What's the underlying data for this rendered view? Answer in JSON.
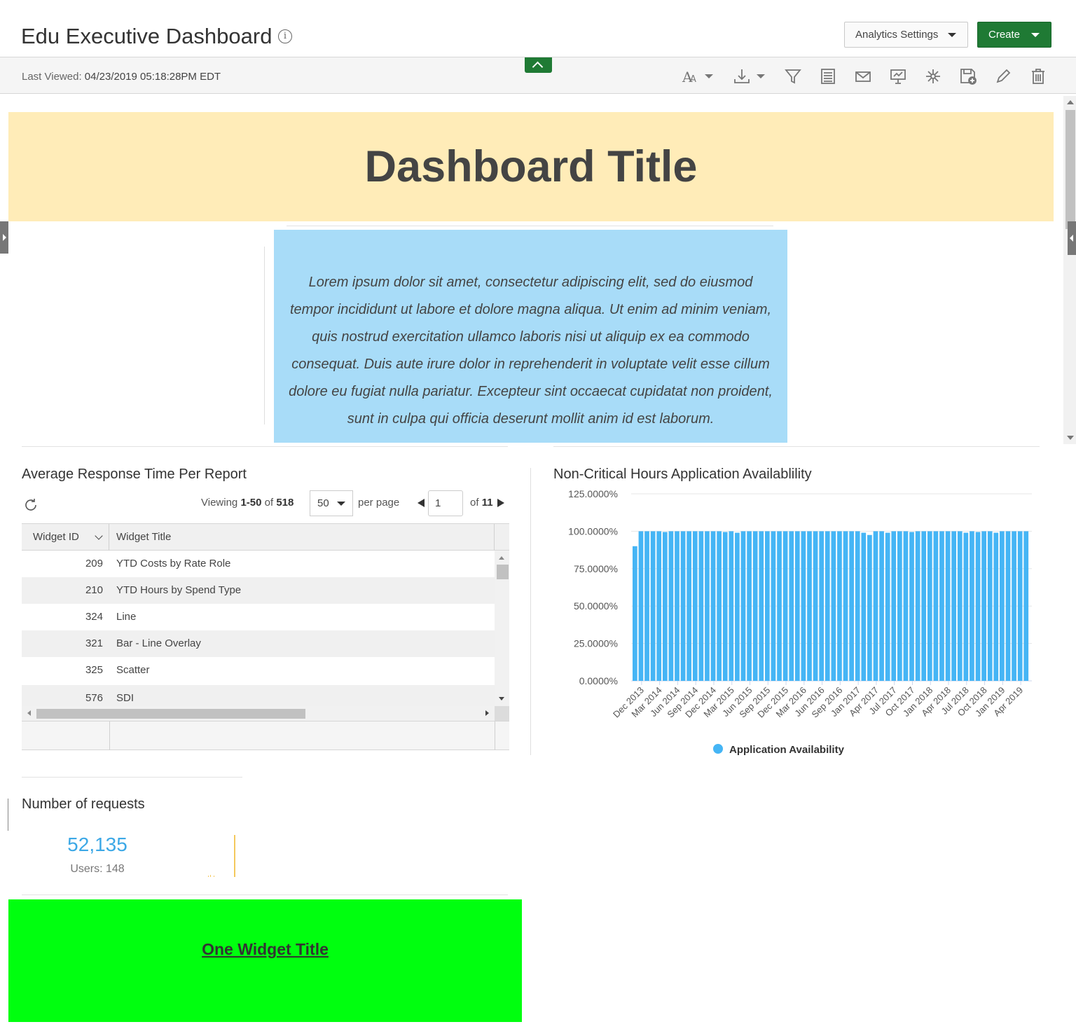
{
  "header": {
    "title": "Edu Executive Dashboard",
    "info_icon": "i",
    "settings_label": "Analytics Settings",
    "create_label": "Create"
  },
  "toolbar": {
    "last_viewed_label": "Last Viewed:",
    "last_viewed_value": "04/23/2019 05:18:28PM EDT",
    "icons": [
      "font-size-icon",
      "download-icon",
      "filter-icon",
      "report-icon",
      "email-icon",
      "presentation-icon",
      "network-icon",
      "save-icon",
      "edit-icon",
      "delete-icon"
    ]
  },
  "banner": {
    "title": "Dashboard Title",
    "background": "#ffecb8"
  },
  "lorem": {
    "text": "Lorem ipsum dolor sit amet, consectetur adipiscing elit, sed do eiusmod tempor incididunt ut labore et dolore magna aliqua. Ut enim ad minim veniam, quis nostrud exercitation ullamco laboris nisi ut aliquip ex ea commodo consequat. Duis aute irure dolor in reprehenderit in voluptate velit esse cillum dolore eu fugiat nulla pariatur. Excepteur sint occaecat cupidatat non proident, sunt in culpa qui officia deserunt mollit anim id est laborum.",
    "background": "#a8dcf8"
  },
  "table_widget": {
    "title": "Average Response Time Per Report",
    "viewing_prefix": "Viewing",
    "viewing_range": "1-50",
    "viewing_of": "of",
    "viewing_total": "518",
    "per_page_value": "50",
    "per_page_label": "per page",
    "page_value": "1",
    "of_label": "of",
    "total_pages": "11",
    "columns": [
      "Widget ID",
      "Widget Title"
    ],
    "rows": [
      {
        "id": "209",
        "title": "YTD Costs by Rate Role"
      },
      {
        "id": "210",
        "title": "YTD Hours by Spend Type"
      },
      {
        "id": "324",
        "title": "Line"
      },
      {
        "id": "321",
        "title": "Bar - Line Overlay"
      },
      {
        "id": "325",
        "title": "Scatter"
      },
      {
        "id": "576",
        "title": "SDI"
      }
    ]
  },
  "chart_widget": {
    "title": "Non-Critical Hours Application Availablility"
  },
  "chart_data": {
    "type": "bar",
    "title": "Non-Critical Hours Application Availablility",
    "ylim": [
      0,
      125
    ],
    "y_ticks": [
      "0.0000%",
      "25.0000%",
      "50.0000%",
      "75.0000%",
      "100.0000%",
      "125.0000%"
    ],
    "x_tick_labels": [
      "Dec 2013",
      "Mar 2014",
      "Jun 2014",
      "Sep 2014",
      "Dec 2014",
      "Mar 2015",
      "Jun 2015",
      "Sep 2015",
      "Dec 2015",
      "Mar 2016",
      "Jun 2016",
      "Sep 2016",
      "Jan 2017",
      "Apr 2017",
      "Jul 2017",
      "Oct 2017",
      "Jan 2018",
      "Apr 2018",
      "Jul 2018",
      "Oct 2018",
      "Jan 2019",
      "Apr 2019"
    ],
    "series": [
      {
        "name": "Application Availability",
        "color": "#45b5f5",
        "values": [
          90,
          100,
          100,
          100,
          100,
          99.5,
          100,
          100,
          100,
          100,
          100,
          100,
          100,
          100,
          100,
          99.5,
          100,
          99,
          100,
          100,
          100,
          100,
          100,
          100,
          100,
          100,
          100,
          100,
          100,
          100,
          100,
          100,
          100,
          100,
          100,
          100,
          100,
          100,
          99,
          97.5,
          100,
          100,
          99,
          100,
          100,
          100,
          99.5,
          100,
          100,
          100,
          100,
          100,
          100,
          100,
          100,
          99,
          100,
          99.5,
          100,
          100,
          99,
          100,
          100,
          100,
          100,
          100
        ]
      }
    ],
    "grid": true,
    "legend": "bottom"
  },
  "metric_widget": {
    "title": "Number of requests",
    "value": "52,135",
    "users": "Users: 148"
  },
  "green_widget": {
    "title": "One Widget Title",
    "background": "#00ff0f"
  }
}
